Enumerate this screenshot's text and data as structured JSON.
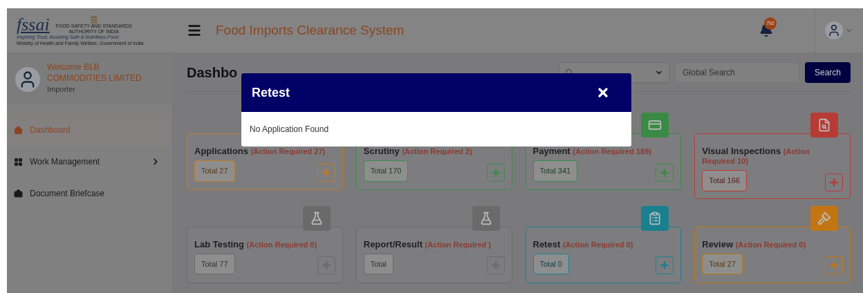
{
  "header": {
    "logo": {
      "wordmark": "fssai",
      "org": "FOOD SAFETY AND STANDARDS AUTHORITY OF INDIA",
      "tagline": "Inspiring Trust, Assuring Safe & Nutritious Food",
      "ministry": "Ministry of Health and Family Welfare, Government of India"
    },
    "title": "Food Imports Clearance System",
    "notifications": "792"
  },
  "sidebar": {
    "welcome": "Welcome BLB COMMODITIES LIMITED",
    "role": "Importer",
    "items": [
      {
        "label": "Dashboard",
        "selected": true
      },
      {
        "label": "Work Management",
        "selected": false
      },
      {
        "label": "Document Briefcase",
        "selected": false
      }
    ]
  },
  "page_title": "Dashbo",
  "search": {
    "placeholder": "Global Search",
    "button": "Search"
  },
  "cards": [
    {
      "title": "Applications",
      "action": "(Action Required 27)",
      "total": "Total 27",
      "color": "#c07a2c"
    },
    {
      "title": "Scrutiny",
      "action": "(Action Required 2)",
      "total": "Total 170",
      "color": "#3e8a4a"
    },
    {
      "title": "Payment",
      "action": "(Action Required 189)",
      "total": "Total 341",
      "color": "#3a8a45"
    },
    {
      "title": "Visual Inspections",
      "action": "(Action Required 10)",
      "total": "Total 166",
      "color": "#b83a35"
    },
    {
      "title": "Lab Testing",
      "action": "(Action Required 0)",
      "total": "Total 77",
      "color": "#6a6a6a"
    },
    {
      "title": "Report/Result",
      "action": "(Action Required )",
      "total": "Total",
      "color": "#6a6a6a"
    },
    {
      "title": "Retest",
      "action": "(Action Required 0)",
      "total": "Total 0",
      "color": "#1a8090"
    },
    {
      "title": "Review",
      "action": "(Action Required 0)",
      "total": "Total 27",
      "color": "#c27512"
    }
  ],
  "modal": {
    "title": "Retest",
    "message": "No Application Found"
  }
}
